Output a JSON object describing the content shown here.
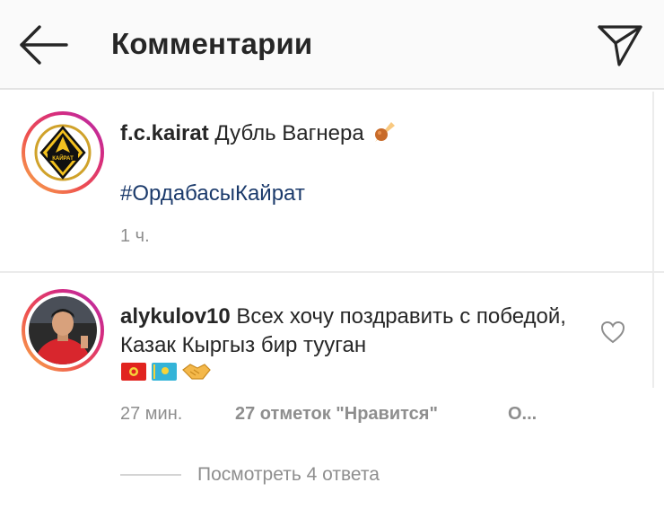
{
  "header": {
    "title": "Комментарии",
    "back_icon": "arrow-left-icon",
    "share_icon": "paper-plane-icon"
  },
  "post": {
    "username": "f.c.kairat",
    "caption": "Дубль Вагнера",
    "emoji": "comet-icon",
    "hashtag": "#ОрдабасыКайрат",
    "time": "1 ч.",
    "avatar": "fc-kairat-logo",
    "logo_text": "КАЙРАТ"
  },
  "comment": {
    "username": "alykulov10",
    "text": "Всех хочу поздравить с победой, Казак Кыргыз бир тууган",
    "emojis": [
      "flag-kyrgyzstan-icon",
      "flag-kazakhstan-icon",
      "handshake-icon"
    ],
    "time": "27 мин.",
    "likes": "27 отметок \"Нравится\"",
    "reply": "О...",
    "view_replies": "Посмотреть 4 ответа",
    "like_icon": "heart-outline-icon"
  },
  "colors": {
    "hashtag": "#1b3a6b",
    "secondary_text": "#8e8e8e",
    "header_bg": "#fafafa"
  }
}
